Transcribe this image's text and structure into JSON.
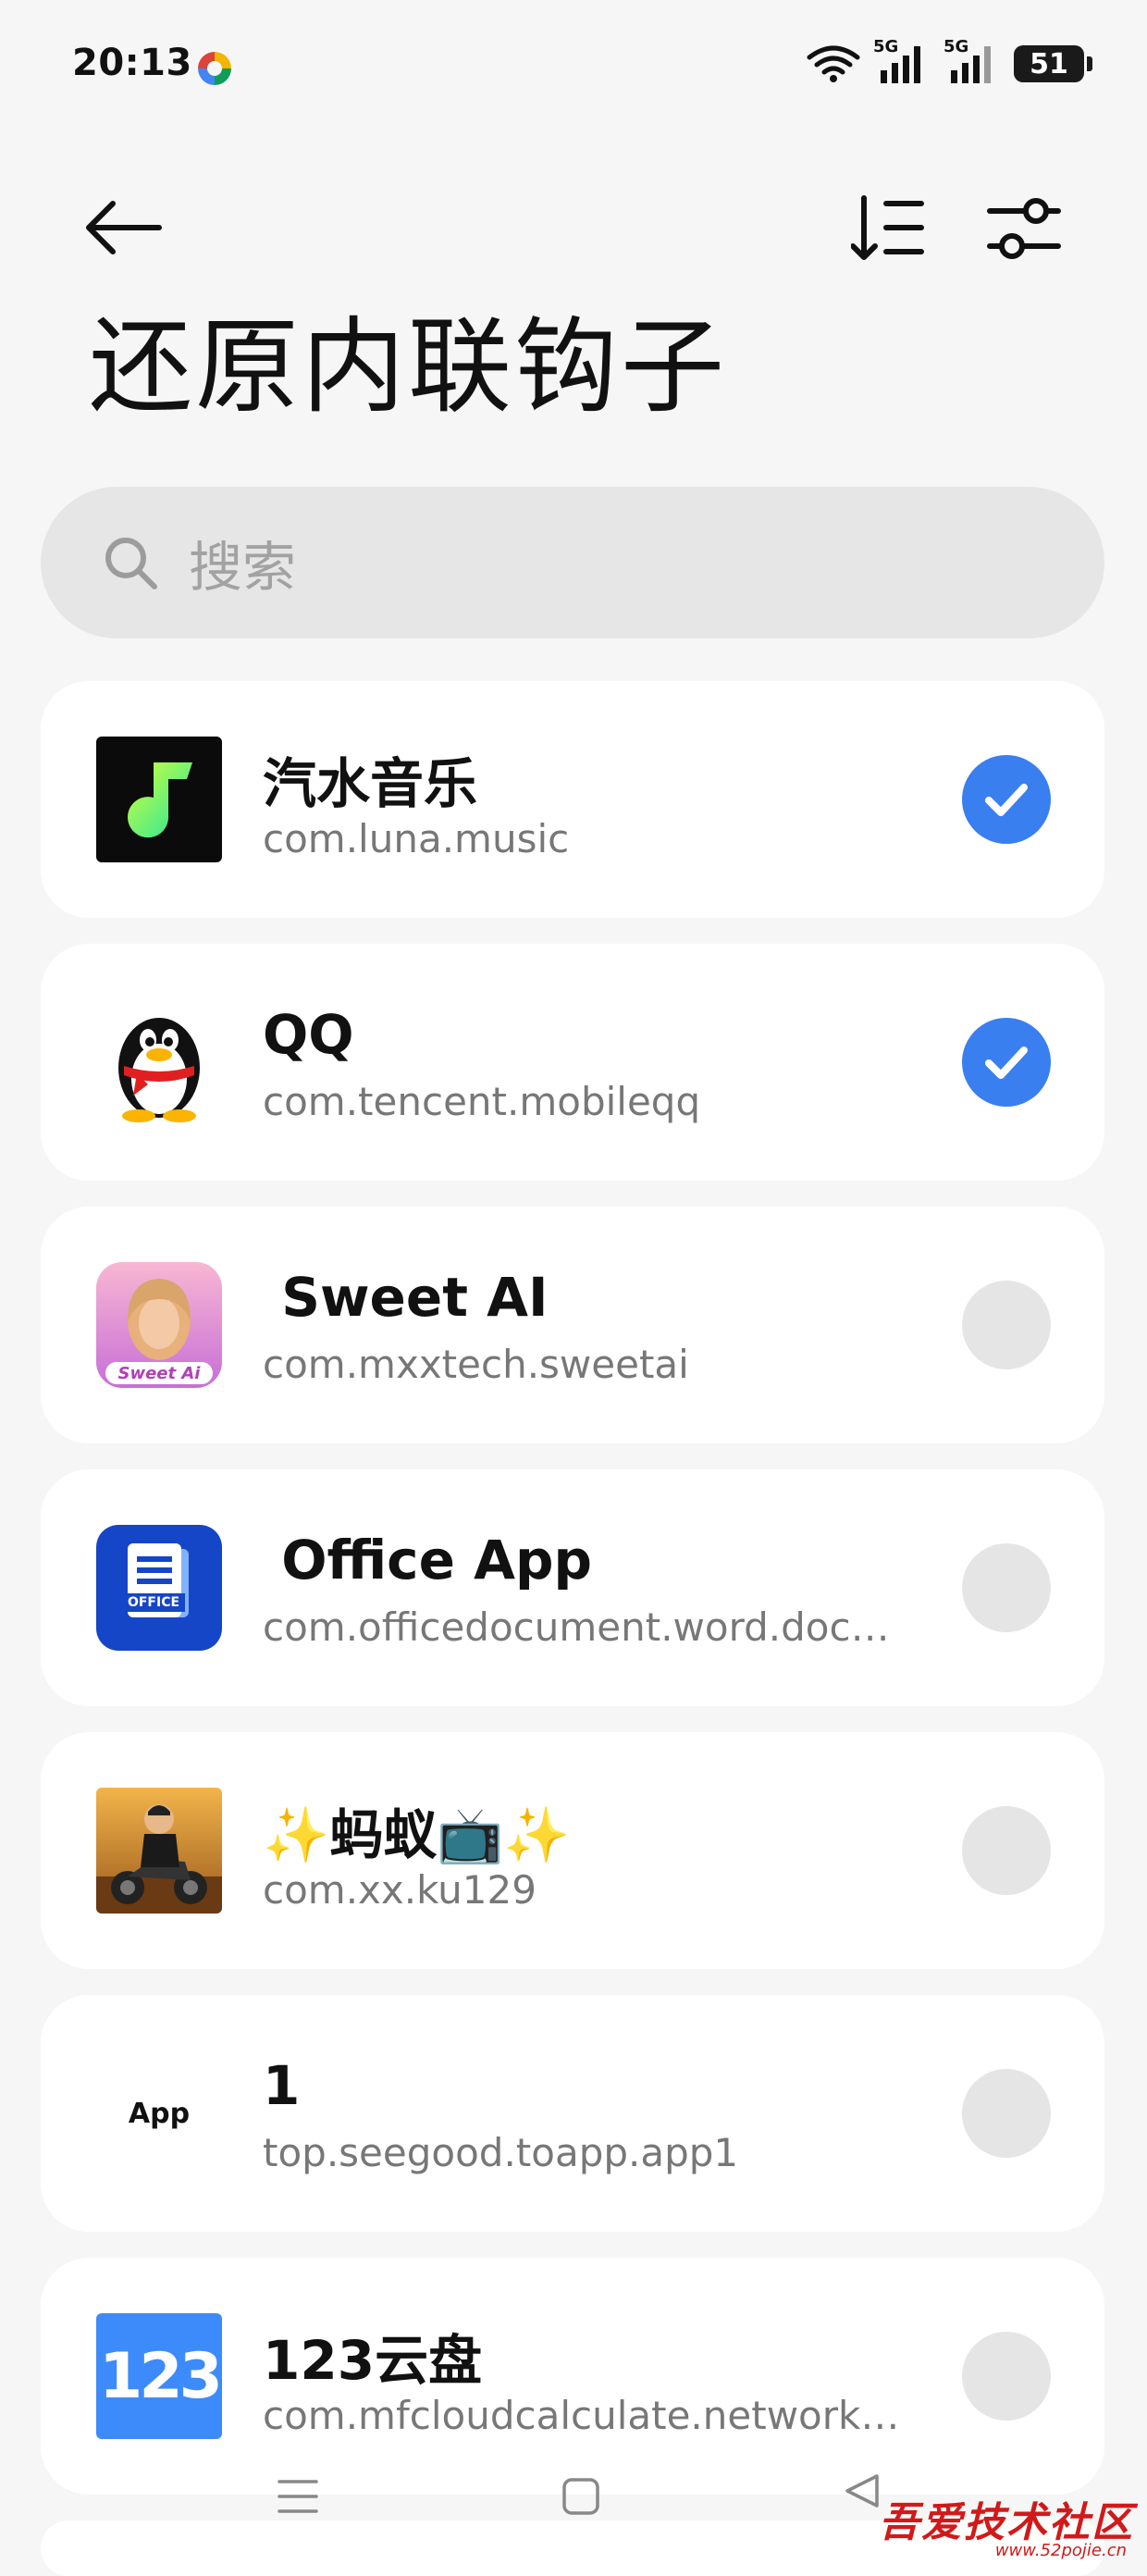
{
  "status_bar": {
    "time": "20:13",
    "signal_1_label": "5G",
    "signal_2_label": "5G",
    "battery": "51"
  },
  "toolbar": {
    "back_icon": "back-arrow-icon",
    "sort_icon": "sort-icon",
    "filter_icon": "filter-icon"
  },
  "page": {
    "title": "还原内联钩子"
  },
  "search": {
    "placeholder": "搜索"
  },
  "apps": [
    {
      "name": "汽水音乐",
      "package": "com.luna.music",
      "checked": true
    },
    {
      "name": "QQ",
      "package": "com.tencent.mobileqq",
      "checked": true
    },
    {
      "name": " Sweet AI",
      "package": "com.mxxtech.sweetai",
      "checked": false,
      "icon_text": "Sweet Ai"
    },
    {
      "name": " Office App",
      "package": "com.officedocument.word.docx.d…",
      "checked": false,
      "icon_text": "OFFICE"
    },
    {
      "name": "✨蚂蚁📺✨",
      "package": "com.xx.ku129",
      "checked": false
    },
    {
      "name": "1",
      "package": "top.seegood.toapp.app1",
      "checked": false,
      "icon_text": "App"
    },
    {
      "name": "123云盘",
      "package": "com.mfcloudcalculate.networkdisk",
      "checked": false,
      "icon_text": "123"
    }
  ],
  "colors": {
    "accent": "#3a7ff0",
    "background": "#f6f6f6",
    "card": "#ffffff"
  },
  "watermark": {
    "text": "吾爱技术社区",
    "url": "www.52pojie.cn"
  }
}
